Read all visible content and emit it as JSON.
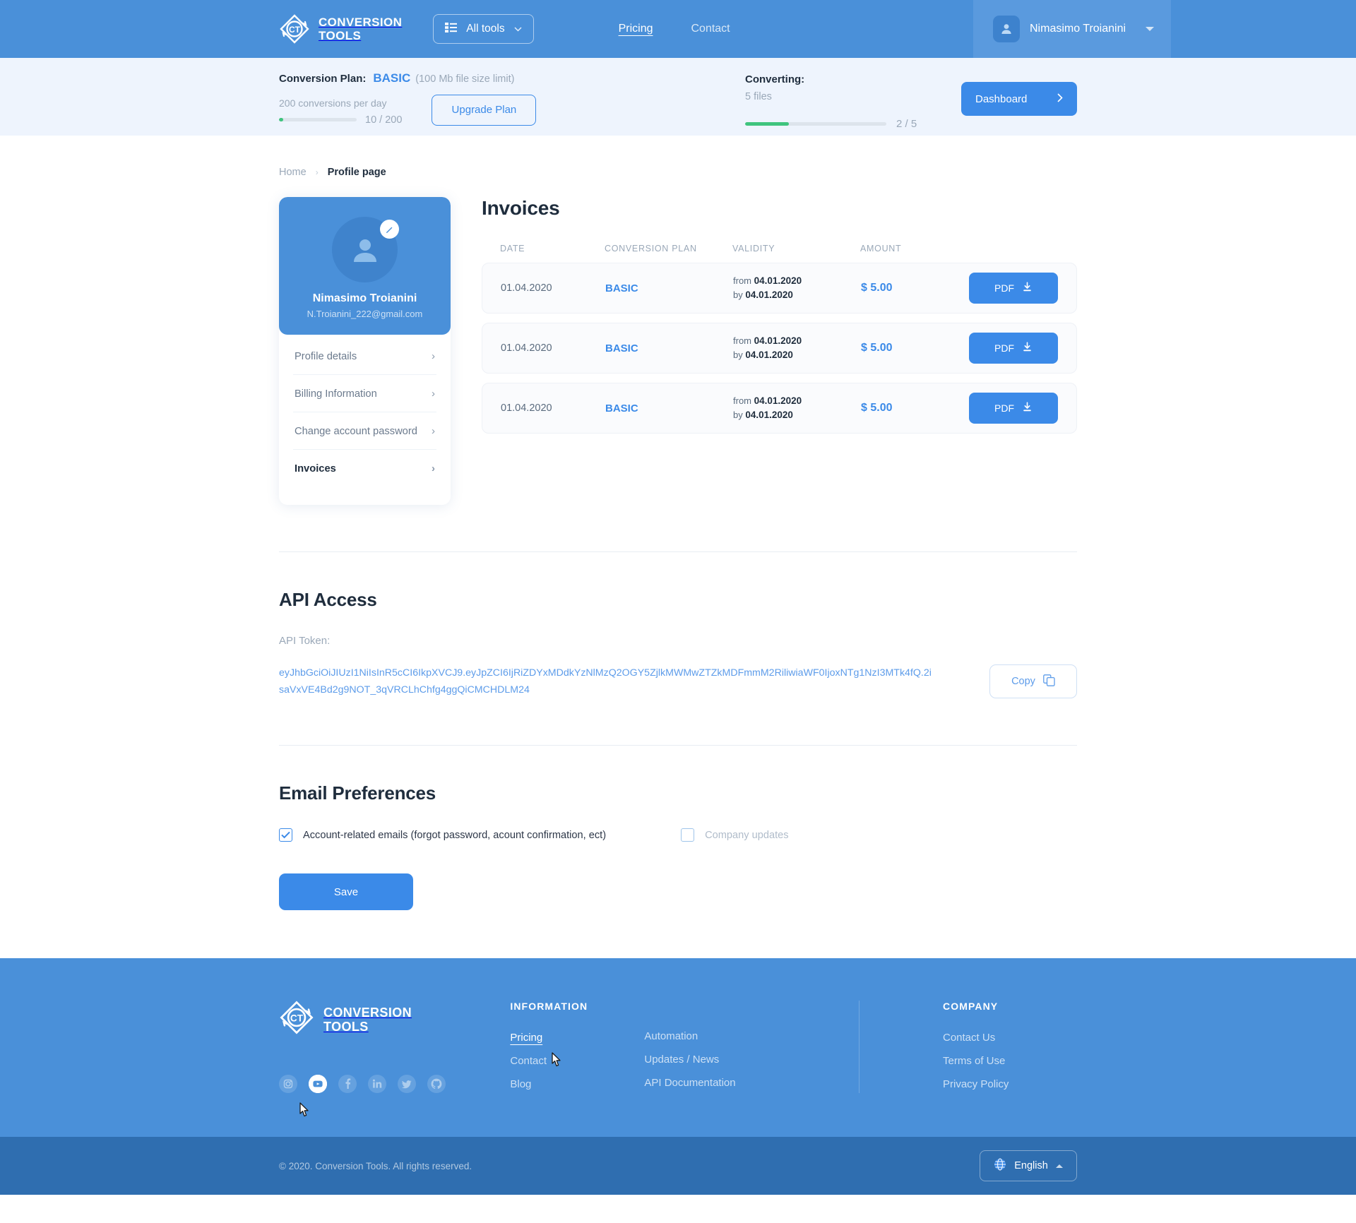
{
  "header": {
    "brand_line1": "CONVERSION",
    "brand_line2": "TOOLS",
    "all_tools": "All tools",
    "nav": [
      {
        "label": "Pricing",
        "active": true
      },
      {
        "label": "Contact",
        "active": false
      }
    ],
    "user_name": "Nimasimo Troianini"
  },
  "plan_bar": {
    "plan_label": "Conversion Plan:",
    "plan_name": "BASIC",
    "plan_limit": "(100 Mb file size limit)",
    "conversions_per_day": "200 conversions per day",
    "conversions_used": "10",
    "conversions_total": "/ 200",
    "conversions_percent": 5,
    "upgrade_label": "Upgrade Plan",
    "converting_title": "Converting:",
    "converting_files": "5 files",
    "converting_done": "2",
    "converting_total": "/ 5",
    "converting_percent": 31,
    "dashboard_label": "Dashboard"
  },
  "breadcrumb": {
    "home": "Home",
    "separator": "›",
    "current": "Profile page"
  },
  "profile_card": {
    "name": "Nimasimo Troianini",
    "email": "N.Troianini_222@gmail.com",
    "menu": [
      {
        "label": "Profile details",
        "active": false
      },
      {
        "label": "Billing Information",
        "active": false
      },
      {
        "label": "Change account password",
        "active": false
      },
      {
        "label": "Invoices",
        "active": true
      }
    ]
  },
  "invoices": {
    "title": "Invoices",
    "columns": [
      "DATE",
      "CONVERSION PLAN",
      "VALIDITY",
      "AMOUNT"
    ],
    "from_label": "from",
    "by_label": "by",
    "pdf_label": "PDF",
    "rows": [
      {
        "date": "01.04.2020",
        "plan": "BASIC",
        "from": "04.01.2020",
        "by": "04.01.2020",
        "amount": "$ 5.00"
      },
      {
        "date": "01.04.2020",
        "plan": "BASIC",
        "from": "04.01.2020",
        "by": "04.01.2020",
        "amount": "$ 5.00"
      },
      {
        "date": "01.04.2020",
        "plan": "BASIC",
        "from": "04.01.2020",
        "by": "04.01.2020",
        "amount": "$ 5.00"
      }
    ]
  },
  "api_access": {
    "title": "API Access",
    "token_label": "API Token:",
    "token": "eyJhbGciOiJIUzI1NiIsInR5cCI6IkpXVCJ9.eyJpZCI6IjRiZDYxMDdkYzNlMzQ2OGY5ZjlkMWMwZTZkMDFmmM2RiliwiaWF0IjoxNTg1NzI3MTk4fQ.2isaVxVE4Bd2g9NOT_3qVRCLhChfg4ggQiCMCHDLM24",
    "copy_label": "Copy"
  },
  "email_prefs": {
    "title": "Email Preferences",
    "options": [
      {
        "label": "Account-related emails (forgot password, acount confirmation, ect)",
        "checked": true
      },
      {
        "label": "Company updates",
        "checked": false
      }
    ],
    "save_label": "Save"
  },
  "footer": {
    "brand_line1": "CONVERSION",
    "brand_line2": "TOOLS",
    "socials": [
      "instagram-icon",
      "youtube-icon",
      "facebook-icon",
      "linkedin-icon",
      "twitter-icon",
      "github-icon"
    ],
    "information_title": "INFORMATION",
    "information_links_col1": [
      {
        "label": "Pricing",
        "active": true
      },
      {
        "label": "Contact",
        "active": false
      },
      {
        "label": "Blog",
        "active": false
      }
    ],
    "information_links_col2": [
      {
        "label": "Automation",
        "active": false
      },
      {
        "label": "Updates / News",
        "active": false
      },
      {
        "label": "API Documentation",
        "active": false
      }
    ],
    "company_title": "COMPANY",
    "company_links": [
      {
        "label": "Contact Us"
      },
      {
        "label": "Terms of Use"
      },
      {
        "label": "Privacy Policy"
      }
    ],
    "copyright": "© 2020. Conversion Tools. All rights reserved.",
    "language": "English"
  },
  "colors": {
    "brand_blue": "#4a90d9",
    "accent_blue": "#3b8ae8",
    "progress_green": "#3fc47e",
    "plan_bar_bg": "#eef4fd",
    "footer_bottom": "#2f6eb0"
  }
}
